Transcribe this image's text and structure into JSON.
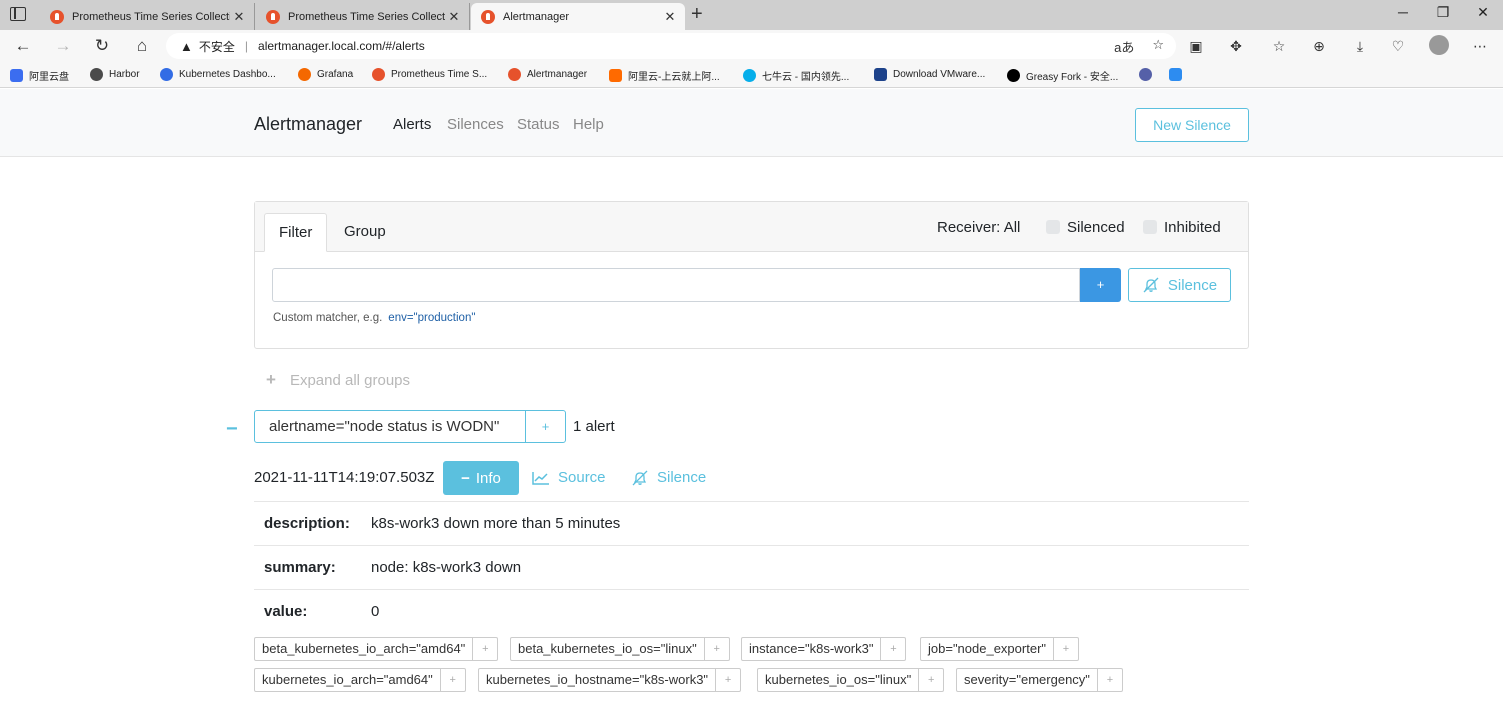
{
  "browser": {
    "tabs": [
      {
        "title": "Prometheus Time Series Collecti",
        "close": "✕"
      },
      {
        "title": "Prometheus Time Series Collecti",
        "close": "✕"
      },
      {
        "title": "Alertmanager",
        "close": "✕"
      }
    ],
    "new_tab": "+",
    "url": "alertmanager.local.com/#/alerts",
    "security_warning": "不安全",
    "bookmarks": [
      {
        "label": "阿里云盘",
        "color": "#3b6df0"
      },
      {
        "label": "Harbor",
        "color": "#4b4b4b"
      },
      {
        "label": "Kubernetes Dashbo...",
        "color": "#326ce5"
      },
      {
        "label": "Grafana",
        "color": "#f46800"
      },
      {
        "label": "Prometheus Time S...",
        "color": "#e6522c"
      },
      {
        "label": "Alertmanager",
        "color": "#e6522c"
      },
      {
        "label": "阿里云-上云就上阿...",
        "color": "#ff6a00"
      },
      {
        "label": "七牛云 - 国内领先...",
        "color": "#06aeea"
      },
      {
        "label": "Download VMware...",
        "color": "#1d428a"
      },
      {
        "label": "Greasy Fork - 安全...",
        "color": "#000000"
      }
    ]
  },
  "navbar": {
    "brand": "Alertmanager",
    "links": [
      "Alerts",
      "Silences",
      "Status",
      "Help"
    ],
    "new_silence": "New Silence"
  },
  "filter": {
    "tabs": [
      "Filter",
      "Group"
    ],
    "receiver": "Receiver: All",
    "silenced": "Silenced",
    "inhibited": "Inhibited",
    "add_button": "+",
    "silence_button": "Silence",
    "hint": "Custom matcher, e.g.",
    "hint_example": "env=\"production\""
  },
  "expand_all": "Expand all groups",
  "group": {
    "collapse": "−",
    "label": "alertname=\"node status is WODN\"",
    "add": "+",
    "count": "1 alert"
  },
  "alert": {
    "timestamp": "2021-11-11T14:19:07.503Z",
    "info_button": "Info",
    "source_link": "Source",
    "silence_link": "Silence",
    "annotations": [
      {
        "key": "description:",
        "value": "k8s-work3 down more than 5 minutes"
      },
      {
        "key": "summary:",
        "value": "node: k8s-work3 down"
      },
      {
        "key": "value:",
        "value": "0"
      }
    ],
    "labels": [
      "beta_kubernetes_io_arch=\"amd64\"",
      "beta_kubernetes_io_os=\"linux\"",
      "instance=\"k8s-work3\"",
      "job=\"node_exporter\"",
      "kubernetes_io_arch=\"amd64\"",
      "kubernetes_io_hostname=\"k8s-work3\"",
      "kubernetes_io_os=\"linux\"",
      "severity=\"emergency\""
    ],
    "label_add": "+"
  },
  "colors": {
    "accent": "#5bc0de",
    "primary": "#3b97e3"
  }
}
